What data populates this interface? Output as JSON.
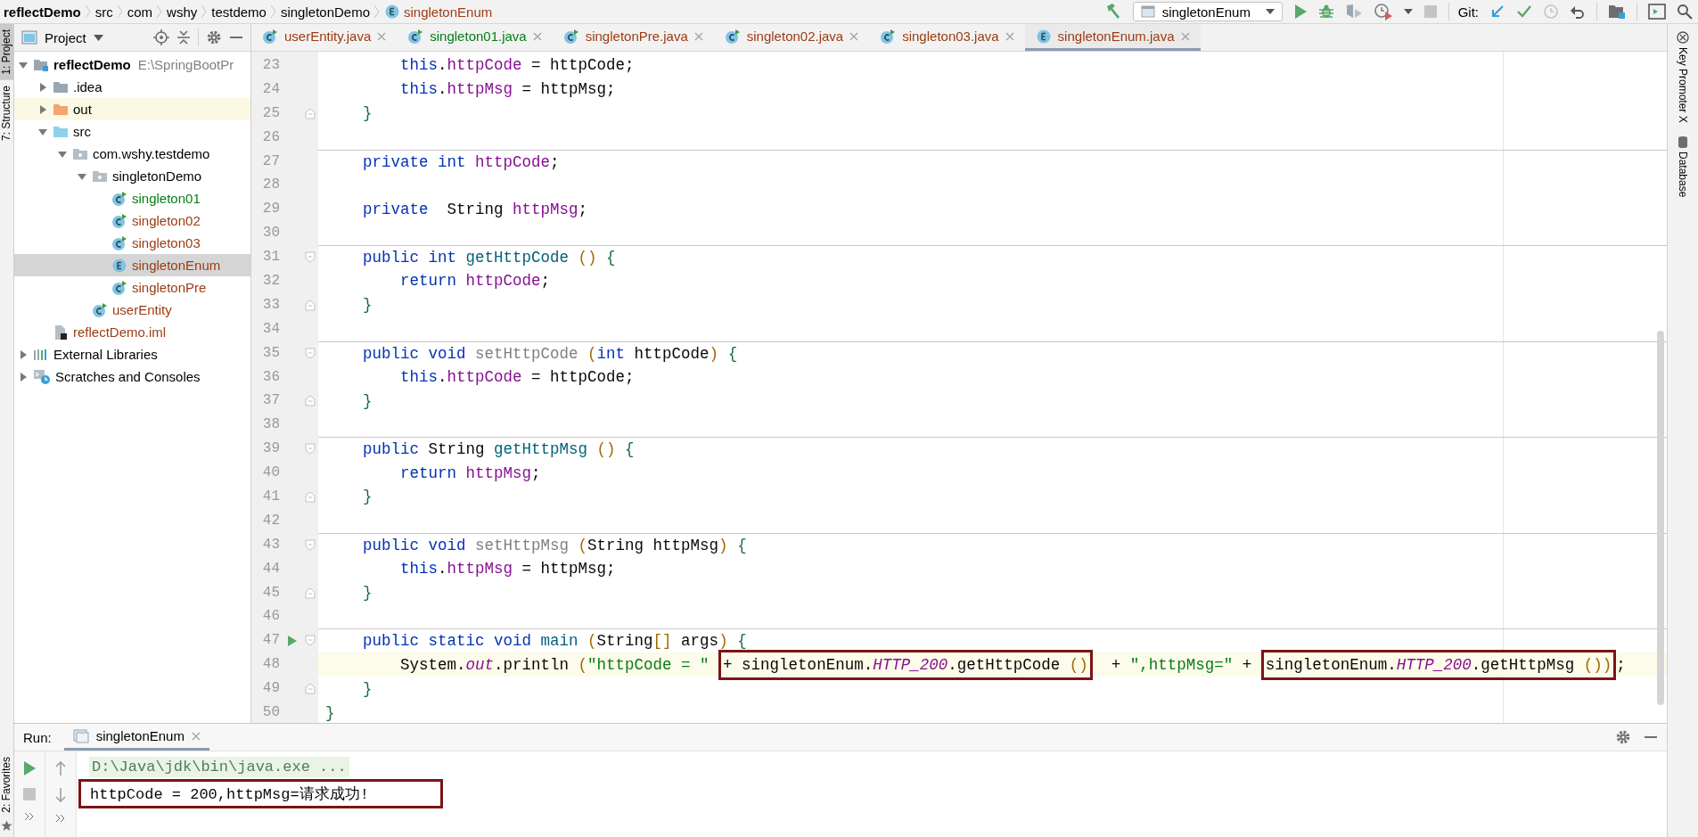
{
  "breadcrumb": [
    {
      "text": "reflectDemo",
      "kind": "project"
    },
    {
      "text": "src",
      "kind": "plain"
    },
    {
      "text": "com",
      "kind": "plain"
    },
    {
      "text": "wshy",
      "kind": "plain"
    },
    {
      "text": "testdemo",
      "kind": "plain"
    },
    {
      "text": "singletonDemo",
      "kind": "plain"
    },
    {
      "text": "singletonEnum",
      "kind": "enum"
    }
  ],
  "toolbar": {
    "run_config": "singletonEnum",
    "vcs_label": "Git:"
  },
  "left_stripe": [
    {
      "label": "1: Project",
      "selected": true
    },
    {
      "label": "7: Structure",
      "selected": false
    }
  ],
  "left_stripe_bottom": [
    {
      "label": "2: Favorites",
      "selected": false
    }
  ],
  "right_stripe": [
    {
      "label": "Key Promoter X",
      "kind": "plugin"
    },
    {
      "label": "Database",
      "kind": "database"
    }
  ],
  "project_panel": {
    "title": "Project",
    "tree": [
      {
        "label": "reflectDemo",
        "kind": "module",
        "path": "E:\\SpringBootPr",
        "color": "#000000",
        "expanded": true,
        "selected": false,
        "highlighted": false,
        "children": [
          {
            "label": ".idea",
            "kind": "folder",
            "color": "#000000",
            "expanded": false,
            "selected": false,
            "highlighted": false
          },
          {
            "label": "out",
            "kind": "excluded-folder",
            "color": "#000000",
            "expanded": false,
            "selected": false,
            "highlighted": true
          },
          {
            "label": "src",
            "kind": "source-folder",
            "color": "#000000",
            "expanded": true,
            "selected": false,
            "highlighted": false,
            "children": [
              {
                "label": "com.wshy.testdemo",
                "kind": "package",
                "color": "#000000",
                "expanded": true,
                "selected": false,
                "highlighted": false,
                "children": [
                  {
                    "label": "singletonDemo",
                    "kind": "package",
                    "color": "#000000",
                    "expanded": true,
                    "selected": false,
                    "highlighted": false,
                    "children": [
                      {
                        "label": "singleton01",
                        "kind": "class",
                        "color": "#067d17",
                        "selected": false,
                        "highlighted": false
                      },
                      {
                        "label": "singleton02",
                        "kind": "class",
                        "color": "#9c3b12",
                        "selected": false,
                        "highlighted": false
                      },
                      {
                        "label": "singleton03",
                        "kind": "class",
                        "color": "#9c3b12",
                        "selected": false,
                        "highlighted": false
                      },
                      {
                        "label": "singletonEnum",
                        "kind": "enum",
                        "color": "#9c3b12",
                        "selected": true,
                        "highlighted": false
                      },
                      {
                        "label": "singletonPre",
                        "kind": "class",
                        "color": "#9c3b12",
                        "selected": false,
                        "highlighted": false
                      }
                    ]
                  },
                  {
                    "label": "userEntity",
                    "kind": "class",
                    "color": "#9c3b12",
                    "selected": false,
                    "highlighted": false
                  }
                ]
              }
            ]
          },
          {
            "label": "reflectDemo.iml",
            "kind": "iml",
            "color": "#9c3b12",
            "selected": false,
            "highlighted": false
          }
        ]
      },
      {
        "label": "External Libraries",
        "kind": "libraries",
        "color": "#000000",
        "expanded": false,
        "selected": false,
        "highlighted": false
      },
      {
        "label": "Scratches and Consoles",
        "kind": "scratches",
        "color": "#000000",
        "expanded": false,
        "selected": false,
        "highlighted": false
      }
    ]
  },
  "editor": {
    "tabs": [
      {
        "label": "userEntity.java",
        "kind": "class",
        "color": "#9c3b12",
        "selected": false
      },
      {
        "label": "singleton01.java",
        "kind": "class",
        "color": "#067d17",
        "selected": false
      },
      {
        "label": "singletonPre.java",
        "kind": "class",
        "color": "#9c3b12",
        "selected": false
      },
      {
        "label": "singleton02.java",
        "kind": "class",
        "color": "#9c3b12",
        "selected": false
      },
      {
        "label": "singleton03.java",
        "kind": "class",
        "color": "#9c3b12",
        "selected": false
      },
      {
        "label": "singletonEnum.java",
        "kind": "enum",
        "color": "#9c3b12",
        "selected": true
      }
    ],
    "lines": [
      {
        "number": "23",
        "tokens": [
          {
            "kind": "keyword",
            "text": "        this"
          },
          {
            "kind": "plain",
            "text": "."
          },
          {
            "kind": "field",
            "text": "httpCode"
          },
          {
            "kind": "plain",
            "text": " = httpCode;"
          }
        ]
      },
      {
        "number": "24",
        "tokens": [
          {
            "kind": "keyword",
            "text": "        this"
          },
          {
            "kind": "plain",
            "text": "."
          },
          {
            "kind": "field",
            "text": "httpMsg"
          },
          {
            "kind": "plain",
            "text": " = httpMsg;"
          }
        ]
      },
      {
        "number": "25",
        "fold_end": true,
        "tokens": [
          {
            "kind": "brace",
            "text": "    }"
          }
        ]
      },
      {
        "number": "26"
      },
      {
        "number": "27",
        "separator": true,
        "tokens": [
          {
            "kind": "keyword",
            "text": "    private int "
          },
          {
            "kind": "field",
            "text": "httpCode"
          },
          {
            "kind": "plain",
            "text": ";"
          }
        ]
      },
      {
        "number": "28"
      },
      {
        "number": "29",
        "tokens": [
          {
            "kind": "keyword",
            "text": "    private"
          },
          {
            "kind": "plain",
            "text": "  String "
          },
          {
            "kind": "field",
            "text": "httpMsg"
          },
          {
            "kind": "plain",
            "text": ";"
          }
        ]
      },
      {
        "number": "30"
      },
      {
        "number": "31",
        "separator": true,
        "fold_start": true,
        "tokens": [
          {
            "kind": "keyword",
            "text": "    public int "
          },
          {
            "kind": "method",
            "text": "getHttpCode "
          },
          {
            "kind": "paren",
            "text": "() "
          },
          {
            "kind": "brace",
            "text": "{"
          }
        ]
      },
      {
        "number": "32",
        "tokens": [
          {
            "kind": "keyword",
            "text": "        return "
          },
          {
            "kind": "field",
            "text": "httpCode"
          },
          {
            "kind": "plain",
            "text": ";"
          }
        ]
      },
      {
        "number": "33",
        "fold_end": true,
        "tokens": [
          {
            "kind": "brace",
            "text": "    }"
          }
        ]
      },
      {
        "number": "34"
      },
      {
        "number": "35",
        "separator": true,
        "fold_start": true,
        "tokens": [
          {
            "kind": "keyword",
            "text": "    public void "
          },
          {
            "kind": "unused",
            "text": "setHttpCode "
          },
          {
            "kind": "paren",
            "text": "("
          },
          {
            "kind": "keyword",
            "text": "int"
          },
          {
            "kind": "plain",
            "text": " httpCode"
          },
          {
            "kind": "paren",
            "text": ") "
          },
          {
            "kind": "brace",
            "text": "{"
          }
        ]
      },
      {
        "number": "36",
        "tokens": [
          {
            "kind": "keyword",
            "text": "        this"
          },
          {
            "kind": "plain",
            "text": "."
          },
          {
            "kind": "field",
            "text": "httpCode"
          },
          {
            "kind": "plain",
            "text": " = httpCode;"
          }
        ]
      },
      {
        "number": "37",
        "fold_end": true,
        "tokens": [
          {
            "kind": "brace",
            "text": "    }"
          }
        ]
      },
      {
        "number": "38"
      },
      {
        "number": "39",
        "separator": true,
        "fold_start": true,
        "tokens": [
          {
            "kind": "keyword",
            "text": "    public"
          },
          {
            "kind": "plain",
            "text": " String "
          },
          {
            "kind": "method",
            "text": "getHttpMsg "
          },
          {
            "kind": "paren",
            "text": "() "
          },
          {
            "kind": "brace",
            "text": "{"
          }
        ]
      },
      {
        "number": "40",
        "tokens": [
          {
            "kind": "keyword",
            "text": "        return "
          },
          {
            "kind": "field",
            "text": "httpMsg"
          },
          {
            "kind": "plain",
            "text": ";"
          }
        ]
      },
      {
        "number": "41",
        "fold_end": true,
        "tokens": [
          {
            "kind": "brace",
            "text": "    }"
          }
        ]
      },
      {
        "number": "42"
      },
      {
        "number": "43",
        "separator": true,
        "fold_start": true,
        "tokens": [
          {
            "kind": "keyword",
            "text": "    public void "
          },
          {
            "kind": "unused",
            "text": "setHttpMsg "
          },
          {
            "kind": "paren",
            "text": "("
          },
          {
            "kind": "plain",
            "text": "String httpMsg"
          },
          {
            "kind": "paren",
            "text": ") "
          },
          {
            "kind": "brace",
            "text": "{"
          }
        ]
      },
      {
        "number": "44",
        "tokens": [
          {
            "kind": "keyword",
            "text": "        this"
          },
          {
            "kind": "plain",
            "text": "."
          },
          {
            "kind": "field",
            "text": "httpMsg"
          },
          {
            "kind": "plain",
            "text": " = httpMsg;"
          }
        ]
      },
      {
        "number": "45",
        "fold_end": true,
        "tokens": [
          {
            "kind": "brace",
            "text": "    }"
          }
        ]
      },
      {
        "number": "46"
      },
      {
        "number": "47",
        "separator": true,
        "fold_start": true,
        "runnable": true,
        "tokens": [
          {
            "kind": "keyword",
            "text": "    public static void "
          },
          {
            "kind": "method",
            "text": "main "
          },
          {
            "kind": "paren",
            "text": "("
          },
          {
            "kind": "plain",
            "text": "String"
          },
          {
            "kind": "paren",
            "text": "[]"
          },
          {
            "kind": "plain",
            "text": " args"
          },
          {
            "kind": "paren",
            "text": ") "
          },
          {
            "kind": "brace",
            "text": "{"
          }
        ]
      },
      {
        "number": "48",
        "current": true,
        "tokens": [
          {
            "kind": "plain",
            "text": "        System."
          },
          {
            "kind": "static",
            "text": "out"
          },
          {
            "kind": "plain",
            "text": ".println "
          },
          {
            "kind": "paren",
            "text": "("
          },
          {
            "kind": "string",
            "text": "\"httpCode = \" "
          },
          {
            "kind": "box",
            "tokens": [
              {
                "kind": "plain",
                "text": "+ singletonEnum."
              },
              {
                "kind": "static",
                "text": "HTTP_200"
              },
              {
                "kind": "plain",
                "text": ".getHttpCode "
              },
              {
                "kind": "paren",
                "text": "()"
              }
            ]
          },
          {
            "kind": "plain",
            "text": "  + "
          },
          {
            "kind": "string",
            "text": "\",httpMsg=\""
          },
          {
            "kind": "plain",
            "text": " + "
          },
          {
            "kind": "box",
            "tokens": [
              {
                "kind": "plain",
                "text": "singletonEnum."
              },
              {
                "kind": "static",
                "text": "HTTP_200"
              },
              {
                "kind": "plain",
                "text": ".getHttpMsg "
              },
              {
                "kind": "paren",
                "text": "())"
              }
            ]
          },
          {
            "kind": "plain",
            "text": ";"
          }
        ]
      },
      {
        "number": "49",
        "fold_end": true,
        "tokens": [
          {
            "kind": "brace",
            "text": "    }"
          }
        ]
      },
      {
        "number": "50",
        "tokens": [
          {
            "kind": "brace",
            "text": "}"
          }
        ]
      }
    ]
  },
  "run_panel": {
    "title": "Run:",
    "tabs": [
      {
        "label": "singletonEnum",
        "selected": true
      }
    ],
    "console": [
      {
        "kind": "command",
        "text": "D:\\Java\\jdk\\bin\\java.exe ...",
        "boxed": false
      },
      {
        "kind": "output",
        "text": "httpCode = 200,httpMsg=请求成功!",
        "boxed": true
      }
    ]
  }
}
